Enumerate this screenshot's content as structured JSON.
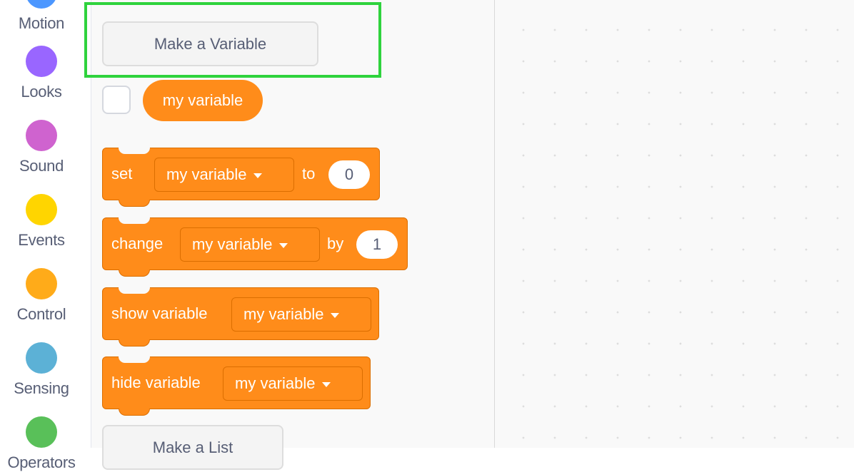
{
  "categories": [
    {
      "label": "Motion",
      "color": "#4c97ff"
    },
    {
      "label": "Looks",
      "color": "#9966ff"
    },
    {
      "label": "Sound",
      "color": "#cf63cf"
    },
    {
      "label": "Events",
      "color": "#ffd500"
    },
    {
      "label": "Control",
      "color": "#ffab19"
    },
    {
      "label": "Sensing",
      "color": "#5cb1d6"
    },
    {
      "label": "Operators",
      "color": "#59c059"
    }
  ],
  "palette": {
    "make_variable_label": "Make a Variable",
    "variable_reporter": "my variable",
    "blocks": {
      "set": {
        "label": "set",
        "dropdown": "my variable",
        "to_label": "to",
        "value": "0"
      },
      "change": {
        "label": "change",
        "dropdown": "my variable",
        "by_label": "by",
        "value": "1"
      },
      "show": {
        "label": "show variable",
        "dropdown": "my variable"
      },
      "hide": {
        "label": "hide variable",
        "dropdown": "my variable"
      }
    },
    "make_list_label": "Make a List"
  },
  "colors": {
    "variables_block": "#ff8c1a",
    "highlight": "#2fd33d"
  }
}
